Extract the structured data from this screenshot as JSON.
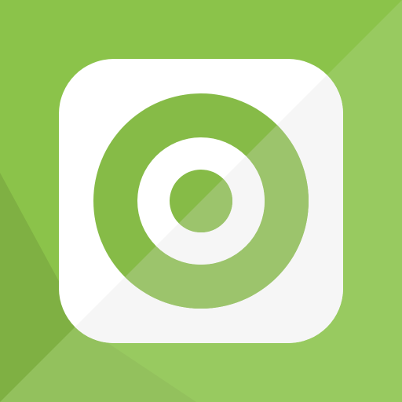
{
  "icon": {
    "name": "target-icon",
    "colors": {
      "background": "#8BC34A",
      "background_highlight": "#A4CF72",
      "long_shadow": "#7FB043",
      "tile": "#FFFFFF",
      "tile_highlight": "#F6F6F6",
      "ring": "#86BB47",
      "ring_highlight": "#9CC46C",
      "center": "#86BB47",
      "center_highlight": "#9CC46C"
    }
  }
}
